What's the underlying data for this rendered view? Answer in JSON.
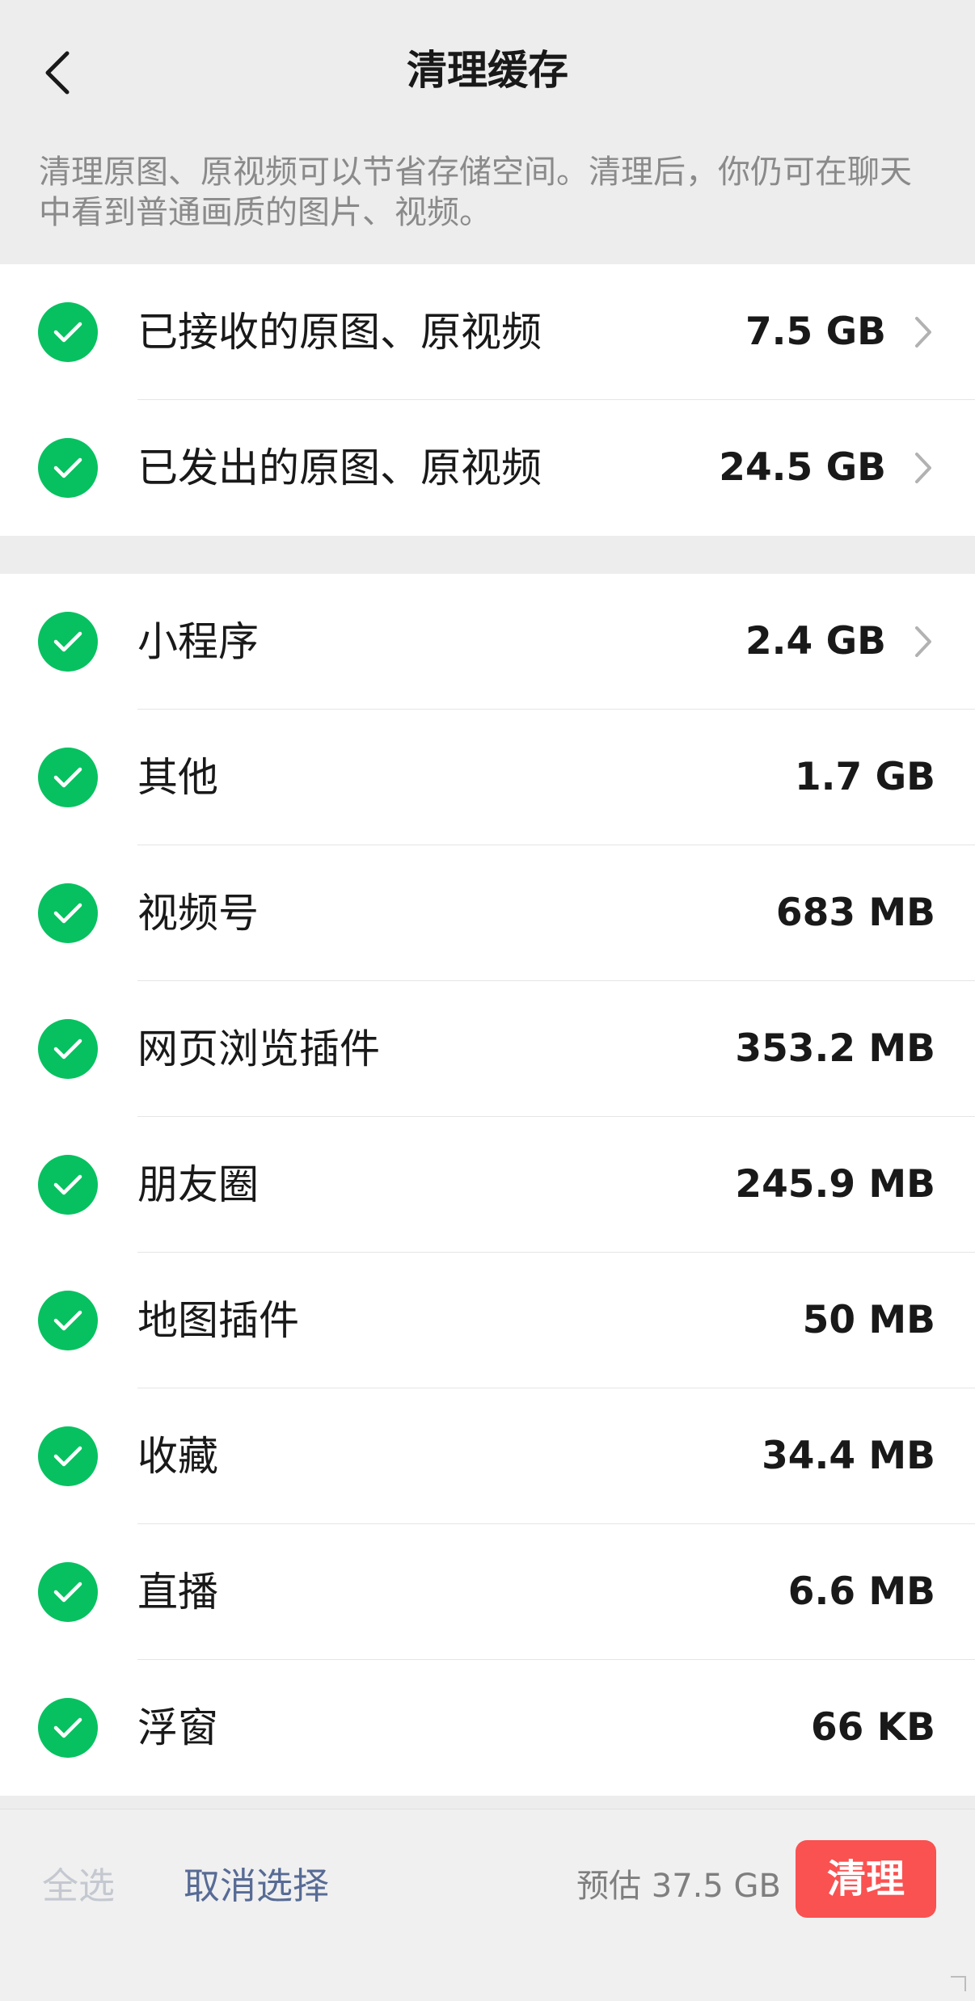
{
  "nav": {
    "title": "清理缓存",
    "back_icon": "chevron-left-icon"
  },
  "description": "清理原图、原视频可以节省存储空间。清理后，你仍可在聊天中看到普通画质的图片、视频。",
  "colors": {
    "check": "#07c160",
    "clean_button": "#fa5151",
    "link": "#576b95",
    "disabled": "#c4c8d0"
  },
  "group1": {
    "items": [
      {
        "label": "已接收的原图、原视频",
        "size": "7.5 GB",
        "checked": true,
        "has_arrow": true
      },
      {
        "label": "已发出的原图、原视频",
        "size": "24.5 GB",
        "checked": true,
        "has_arrow": true
      }
    ]
  },
  "group2": {
    "items": [
      {
        "label": "小程序",
        "size": "2.4 GB",
        "checked": true,
        "has_arrow": true
      },
      {
        "label": "其他",
        "size": "1.7 GB",
        "checked": true,
        "has_arrow": false
      },
      {
        "label": "视频号",
        "size": "683 MB",
        "checked": true,
        "has_arrow": false
      },
      {
        "label": "网页浏览插件",
        "size": "353.2 MB",
        "checked": true,
        "has_arrow": false
      },
      {
        "label": "朋友圈",
        "size": "245.9 MB",
        "checked": true,
        "has_arrow": false
      },
      {
        "label": "地图插件",
        "size": "50 MB",
        "checked": true,
        "has_arrow": false
      },
      {
        "label": "收藏",
        "size": "34.4 MB",
        "checked": true,
        "has_arrow": false
      },
      {
        "label": "直播",
        "size": "6.6 MB",
        "checked": true,
        "has_arrow": false
      },
      {
        "label": "浮窗",
        "size": "66 KB",
        "checked": true,
        "has_arrow": false
      }
    ]
  },
  "bottom": {
    "select_all": "全选",
    "deselect": "取消选择",
    "estimate": "预估 37.5 GB",
    "clean": "清理"
  }
}
